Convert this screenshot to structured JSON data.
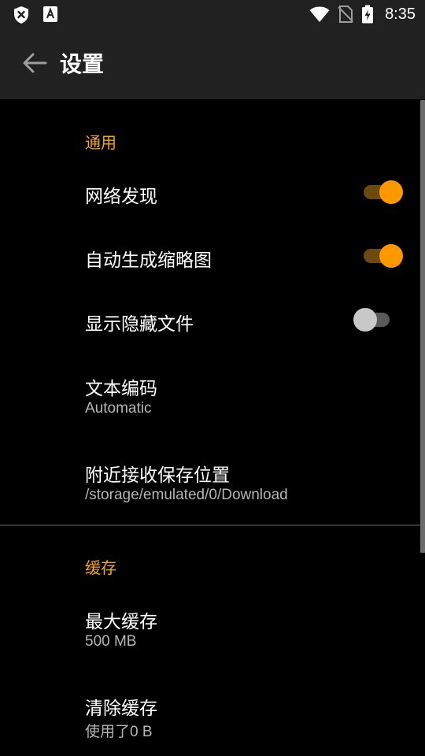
{
  "status_bar": {
    "time": "8:35",
    "icons": [
      "shield-x-icon",
      "font-a-icon",
      "wifi-icon",
      "no-sim-icon",
      "battery-charging-icon"
    ]
  },
  "app_bar": {
    "title": "设置",
    "back_icon": "arrow-left-icon"
  },
  "sections": {
    "general": {
      "header": "通用",
      "network_discovery": {
        "label": "网络发现",
        "enabled": true
      },
      "auto_thumbnails": {
        "label": "自动生成缩略图",
        "enabled": true
      },
      "show_hidden": {
        "label": "显示隐藏文件",
        "enabled": false
      },
      "text_encoding": {
        "label": "文本编码",
        "value": "Automatic"
      },
      "nearby_location": {
        "label": "附近接收保存位置",
        "value": "/storage/emulated/0/Download"
      }
    },
    "cache": {
      "header": "缓存",
      "max_cache": {
        "label": "最大缓存",
        "value": "500 MB"
      },
      "clear_cache": {
        "label": "清除缓存",
        "value": "使用了0 B"
      }
    }
  },
  "colors": {
    "accent": "#FF9800",
    "section_header": "#F5A623",
    "background": "#000000",
    "bar": "#212121"
  }
}
